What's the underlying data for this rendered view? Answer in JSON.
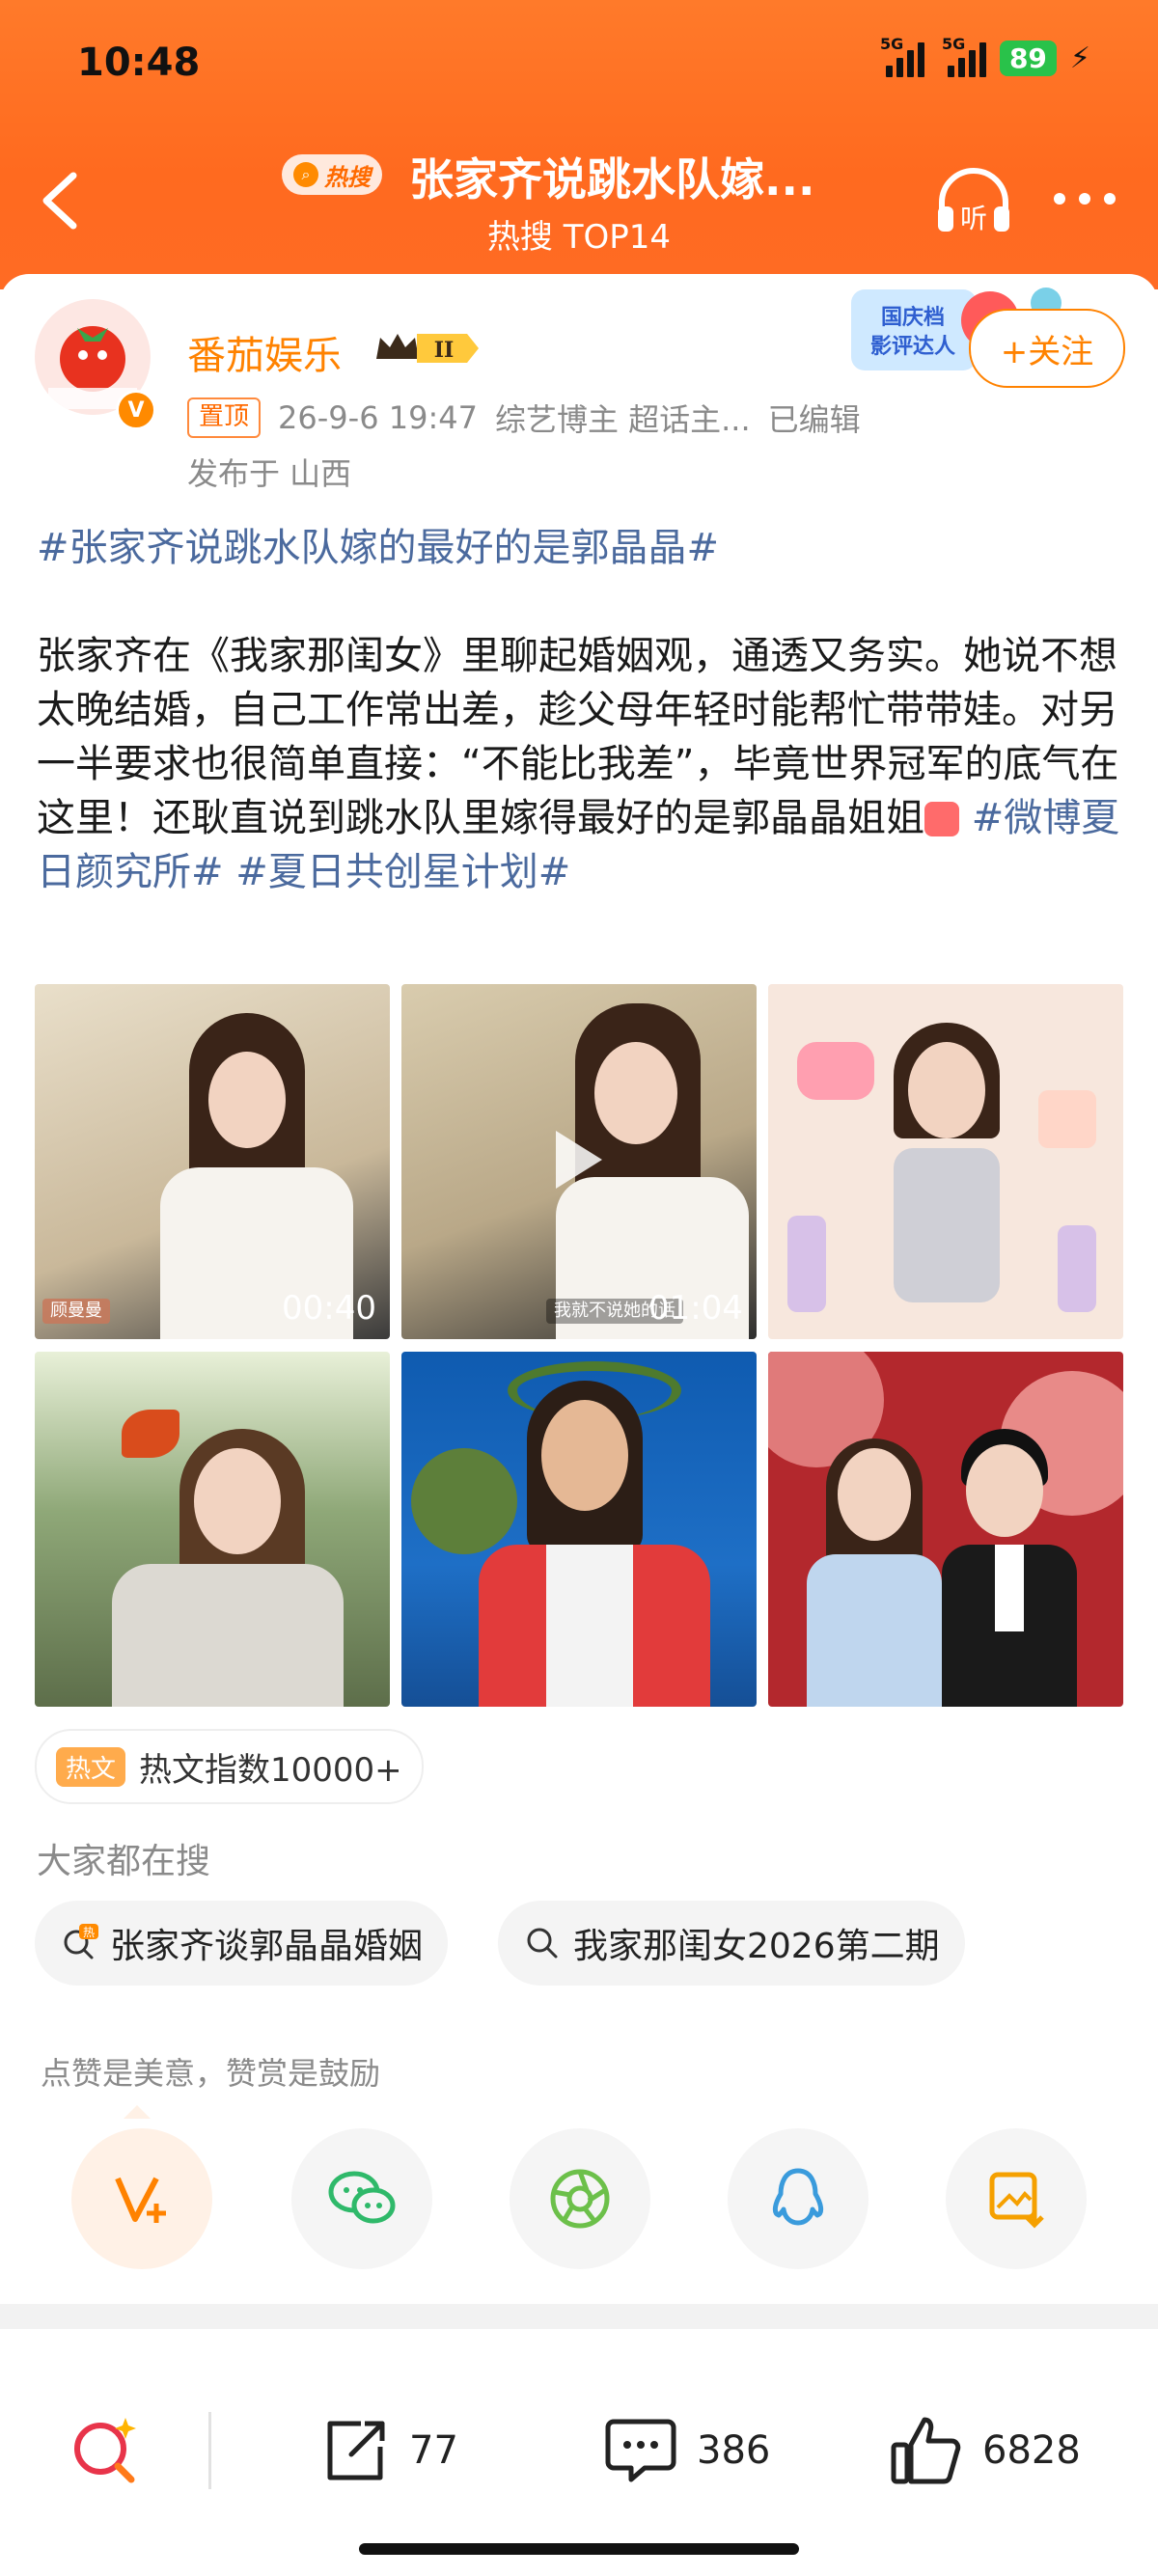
{
  "status_bar": {
    "time": "10:48",
    "network_1": "5G",
    "network_2": "5G",
    "battery": "89"
  },
  "header": {
    "hot_label": "热搜",
    "title": "张家齐说跳水队嫁...",
    "subtitle": "热搜 TOP14",
    "listen_label": "听"
  },
  "post": {
    "author": "番茄娱乐",
    "level": "II",
    "pinned": "置顶",
    "date": "26-9-6 19:47",
    "source": "综艺博主 超话主...",
    "edited": "已编辑",
    "location": "发布于 山西",
    "follow_label": "+关注",
    "promo_text_1": "国庆档",
    "promo_text_2": "影评达人",
    "title_tag": "#张家齐说跳水队嫁的最好的是郭晶晶#",
    "body": "张家齐在《我家那闺女》里聊起婚姻观，通透又务实。她说不想太晚结婚，自己工作常出差，趁父母年轻时能帮忙带带娃。对另一半要求也很简单直接：“不能比我差”，毕竟世界冠军的底气在这里！还耿直说到跳水队里嫁得最好的是郭晶晶姐姐",
    "tag_1": "#微博夏日颜究所#",
    "tag_2": "#夏日共创星计划#",
    "videos": [
      {
        "duration": "00:40",
        "caption": "顾曼曼"
      },
      {
        "duration": "01:04",
        "caption": "我就不说她的话"
      }
    ]
  },
  "hot_index": {
    "tag": "热文",
    "text": "热文指数10000+"
  },
  "search": {
    "label": "大家都在搜",
    "chips": [
      "张家齐谈郭晶晶婚姻",
      "我家那闺女2026第二期"
    ],
    "hot_mark": "热"
  },
  "encourage_text": "点赞是美意，赞赏是鼓励",
  "share": {
    "icons": [
      "reward-v-icon",
      "wechat-icon",
      "moments-icon",
      "qq-icon",
      "save-image-icon"
    ]
  },
  "bottom_bar": {
    "reposts": "77",
    "comments": "386",
    "likes": "6828"
  },
  "colors": {
    "brand_orange": "#ff8200",
    "header": "#ff6a1f",
    "hashtag": "#4b6a9e"
  }
}
